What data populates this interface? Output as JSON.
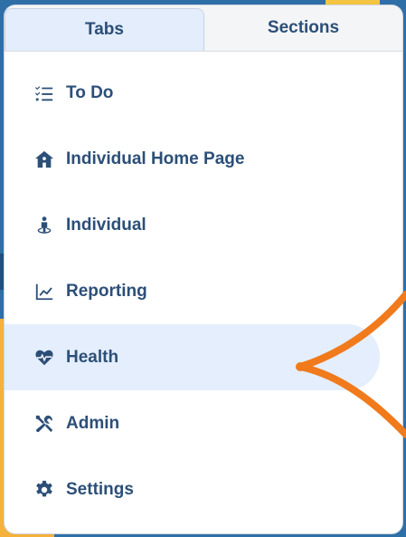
{
  "tabs": [
    {
      "label": "Tabs",
      "active": true
    },
    {
      "label": "Sections",
      "active": false
    }
  ],
  "menu": {
    "items": [
      {
        "label": "To Do",
        "icon": "checklist-icon"
      },
      {
        "label": "Individual Home Page",
        "icon": "house-person-icon"
      },
      {
        "label": "Individual",
        "icon": "person-pin-icon"
      },
      {
        "label": "Reporting",
        "icon": "line-chart-icon"
      },
      {
        "label": "Health",
        "icon": "heart-pulse-icon",
        "selected": true
      },
      {
        "label": "Admin",
        "icon": "tools-icon"
      },
      {
        "label": "Settings",
        "icon": "gear-icon"
      }
    ]
  },
  "colors": {
    "text": "#2c4f78",
    "selected_bg": "#e4eefc",
    "annotation_arrow": "#f07a1c"
  }
}
